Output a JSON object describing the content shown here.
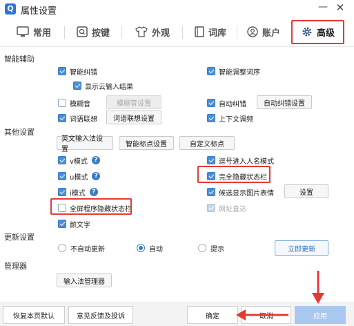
{
  "window": {
    "title": "属性设置",
    "logo_letter": "Q",
    "minimize": "—",
    "close": "✕"
  },
  "tabs": [
    {
      "label": "常用",
      "icon": "monitor-icon"
    },
    {
      "label": "按键",
      "icon": "keyboard-key-icon"
    },
    {
      "label": "外观",
      "icon": "tshirt-icon"
    },
    {
      "label": "词库",
      "icon": "book-icon"
    },
    {
      "label": "账户",
      "icon": "user-icon"
    },
    {
      "label": "高级",
      "icon": "gear-icon",
      "active": true
    }
  ],
  "sections": {
    "smart_assist": {
      "title": "智能辅助",
      "smart_correction": "智能纠错",
      "smart_order": "智能调整词序",
      "show_cloud": "显示云输入结果",
      "fuzzy": "模糊音",
      "fuzzy_settings": "模糊音设置",
      "auto_correct": "自动纠错",
      "auto_correct_settings": "自动纠错设置",
      "assoc": "词语联想",
      "assoc_settings": "词语联想设置",
      "context_adjust": "上下文调频"
    },
    "other": {
      "title": "其他设置",
      "english_settings": "英文输入法设置",
      "punct_settings": "智能标点设置",
      "custom_punct": "自定义标点",
      "v_mode": "v模式",
      "name_mode": "逗号进入人名模式",
      "u_mode": "u模式",
      "hide_status": "完全隐藏状态栏",
      "i_mode": "i模式",
      "show_images": "候选显示图片表情",
      "settings_btn": "设置",
      "fullscreen_hide": "全屏程序隐藏状态栏",
      "web_direct": "网址直达",
      "emoticon": "颜文字"
    },
    "update": {
      "title": "更新设置",
      "no_auto": "不自动更新",
      "auto": "自动",
      "notify": "提示",
      "update_now": "立即更新"
    },
    "manager": {
      "title": "管理器",
      "ime_manager": "输入法管理器"
    }
  },
  "footer": {
    "restore": "恢复本页默认",
    "feedback": "意见反馈及投诉",
    "ok": "确定",
    "cancel": "取消",
    "apply": "应用"
  },
  "colors": {
    "accent": "#3a7bc8",
    "highlight": "#e53935"
  }
}
